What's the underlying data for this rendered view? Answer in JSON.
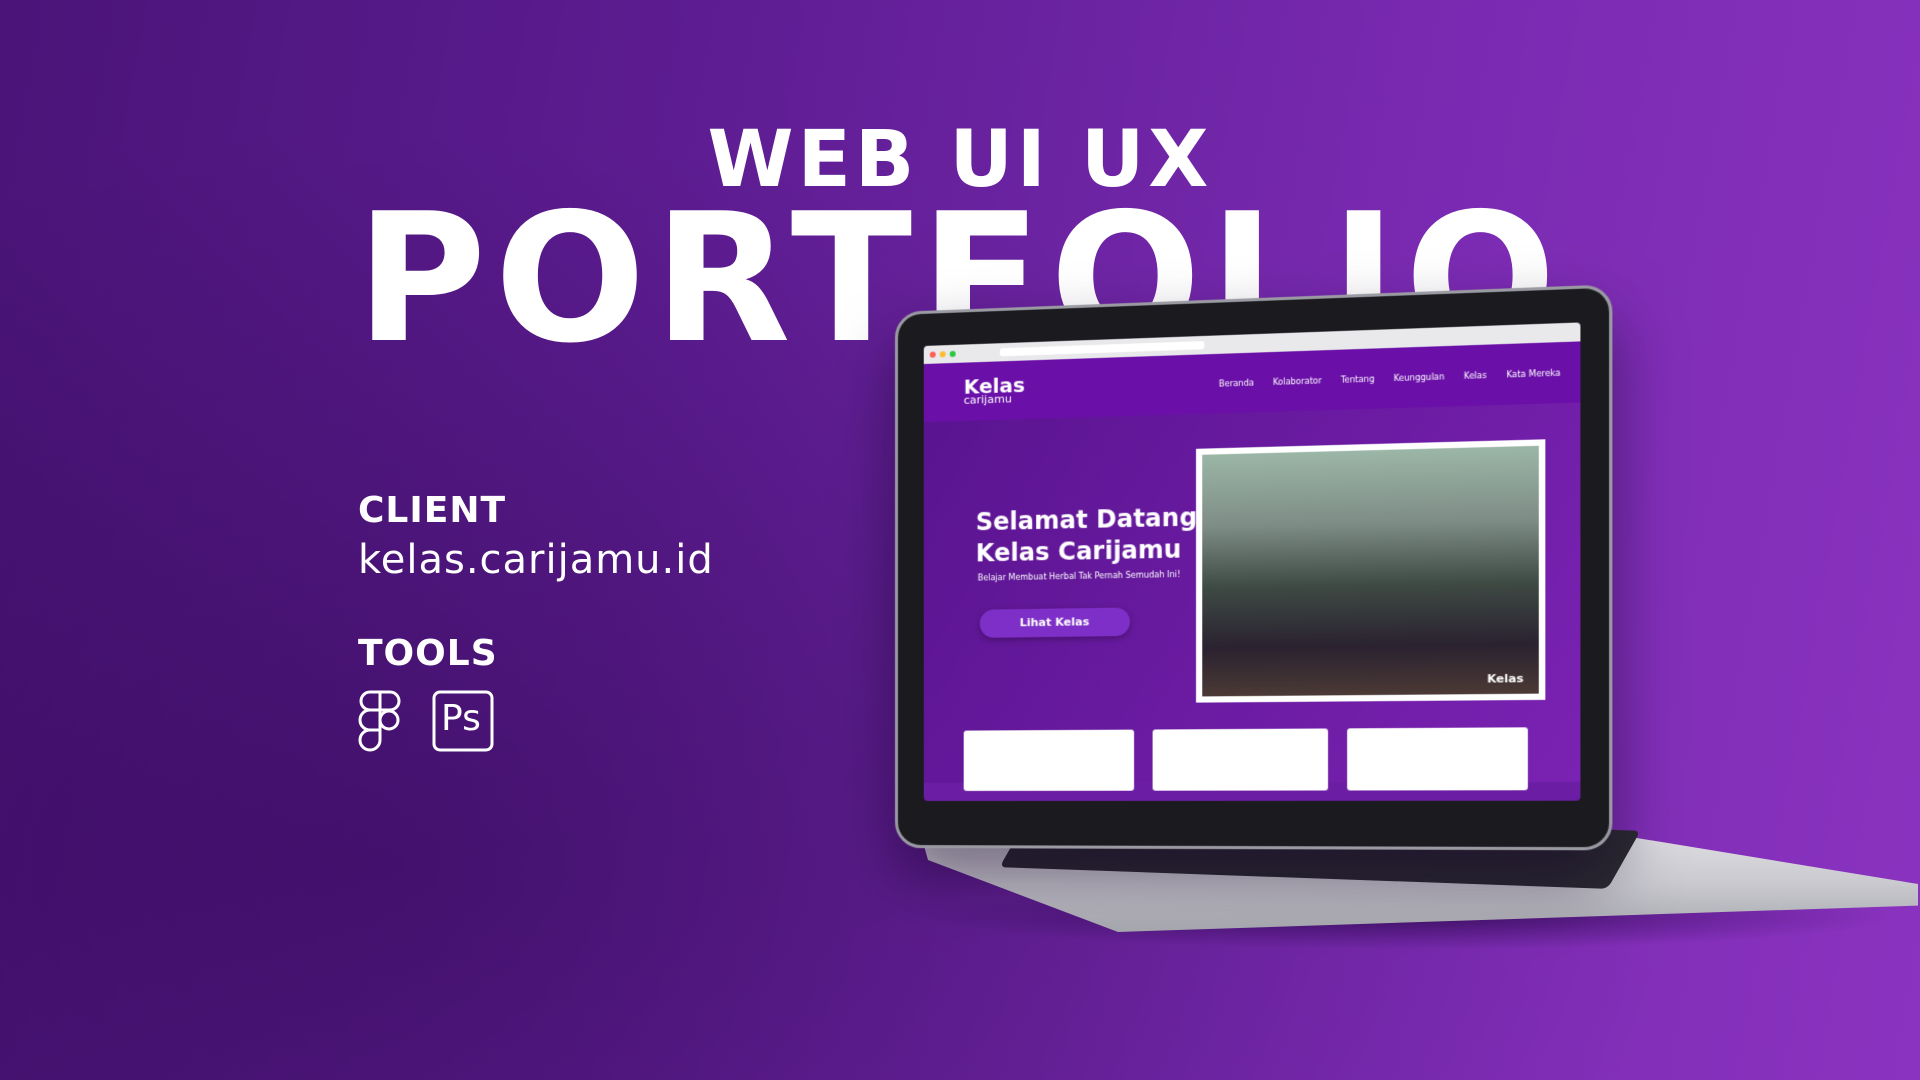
{
  "hero": {
    "line1": "WEB UI UX",
    "line2": "PORTFOLIO"
  },
  "client": {
    "label": "CLIENT",
    "value": "kelas.carijamu.id"
  },
  "tools": {
    "label": "TOOLS",
    "icons": [
      "figma-icon",
      "photoshop-icon"
    ],
    "ps_text": "Ps"
  },
  "site": {
    "logo_main": "Kelas",
    "logo_sub": "carijamu",
    "nav": [
      "Beranda",
      "Kolaborator",
      "Tentang",
      "Keunggulan",
      "Kelas",
      "Kata Mereka"
    ],
    "welcome_line1": "Selamat Datang",
    "welcome_line2": "Kelas Carijamu",
    "subtitle": "Belajar Membuat Herbal Tak Pernah Semudah Ini!",
    "cta": "Lihat Kelas",
    "photo_watermark": "Kelas"
  },
  "colors": {
    "bg_start": "#4a1478",
    "bg_end": "#8a33c0",
    "nav": "#6a0fa8",
    "button": "#7e2fc7"
  }
}
